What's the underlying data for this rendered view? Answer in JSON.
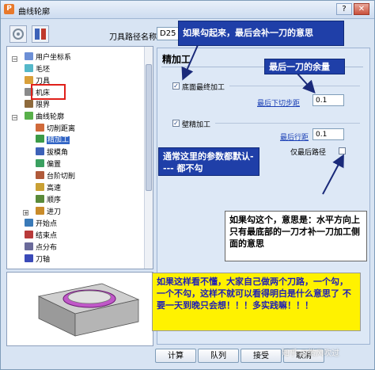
{
  "window": {
    "title": "曲线轮廓",
    "app_icon": "P",
    "close_glyph": "✕",
    "help_glyph": "?"
  },
  "header": {
    "path_label": "刀具路径名称",
    "path_value": "D25"
  },
  "tree": {
    "items": [
      {
        "label": "用户坐标系",
        "icon": "ucs-icon",
        "color": "#6c8fd6"
      },
      {
        "label": "毛坯",
        "icon": "block-icon",
        "color": "#55b8c9"
      },
      {
        "label": "刀具",
        "icon": "tool-icon",
        "color": "#d9a03a"
      },
      {
        "label": "机床",
        "icon": "machine-icon",
        "color": "#8a8a8a"
      },
      {
        "label": "限界",
        "icon": "boundary-icon",
        "color": "#8e6a3c"
      },
      {
        "label": "曲线轮廓",
        "icon": "curve-profile-icon",
        "color": "#58b04a"
      },
      {
        "label": "切削距离",
        "icon": "cut-distance-icon",
        "color": "#d06a3a"
      },
      {
        "label": "精加工",
        "icon": "finishing-icon",
        "color": "#3c9b47",
        "selected": true
      },
      {
        "label": "拔模角",
        "icon": "draft-angle-icon",
        "color": "#3d62b8"
      },
      {
        "label": "偏置",
        "icon": "offset-icon",
        "color": "#3aa060"
      },
      {
        "label": "台阶切削",
        "icon": "step-cut-icon",
        "color": "#b05a3a"
      },
      {
        "label": "高速",
        "icon": "high-speed-icon",
        "color": "#c9a034"
      },
      {
        "label": "顺序",
        "icon": "order-icon",
        "color": "#5a8a3a"
      },
      {
        "label": "进刀",
        "icon": "lead-in-icon",
        "color": "#c98b2a"
      },
      {
        "label": "开始点",
        "icon": "start-point-icon",
        "color": "#3a7ab8"
      },
      {
        "label": "结束点",
        "icon": "end-point-icon",
        "color": "#b83a3a"
      },
      {
        "label": "点分布",
        "icon": "point-distribution-icon",
        "color": "#6a6a9a"
      },
      {
        "label": "刀轴",
        "icon": "tool-axis-icon",
        "color": "#3a4ab8"
      }
    ]
  },
  "panel": {
    "title": "精加工",
    "bottom_finish": {
      "label": "底面最终加工",
      "checked": true
    },
    "final_stepdown": {
      "label": "最后下切步距",
      "value": "0.1"
    },
    "wall_finish": {
      "label": "壁精加工",
      "checked": true
    },
    "final_stepover": {
      "label": "最后行距",
      "value": "0.1"
    },
    "last_path_only": {
      "label": "仅最后路径",
      "checked": false
    }
  },
  "notes": {
    "top": "如果勾起来，最后会补一刀的意思",
    "allowance": "最后一刀的余量",
    "defaults": "通常这里的参数都默认---- 都不勾",
    "bottom_only": "如果勾这个，意思是：水平方向上只有最底部的一刀才补一刀加工侧面的意思",
    "advice": "如果这样看不懂，大家自己做两个刀路，一个勾，一个不勾，这样不就可以看得明白是什么意思了 不要一天到晚只会想！！！多实践嘛！！！"
  },
  "buttons": {
    "calculate": "计算",
    "queue": "队列",
    "accept": "接受",
    "cancel": "取消"
  },
  "watermark": "知乎 @微风吹过",
  "colors": {
    "note_blue": "#1f3fa8",
    "note_yellow": "#fff200",
    "selection_box": "#e0201a",
    "arrow": "#1a2a7a"
  }
}
